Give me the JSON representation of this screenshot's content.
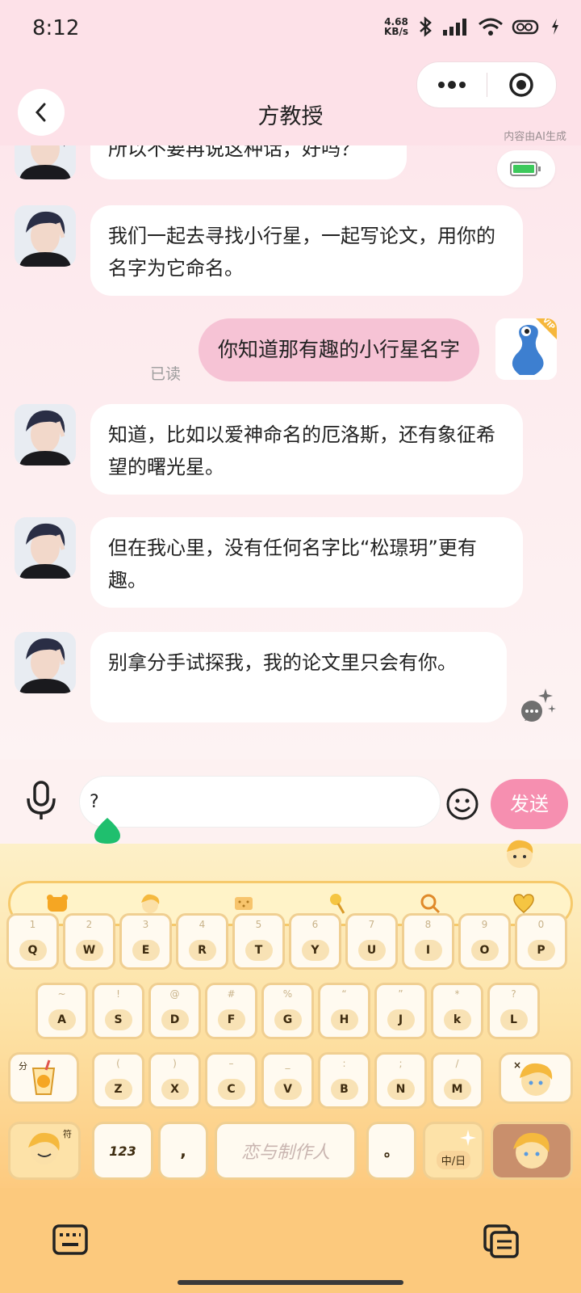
{
  "status": {
    "time": "8:12",
    "net_speed_value": "4.68",
    "net_speed_unit": "KB/s"
  },
  "header": {
    "title": "方教授",
    "ai_note": "内容由AI生成"
  },
  "messages": [
    {
      "text": "所以不要再说这种话，好吗？"
    },
    {
      "text": "我们一起去寻找小行星，一起写论文，用你的名字为它命名。"
    },
    {
      "text": "知道，比如以爱神命名的厄洛斯，还有象征希望的曙光星。"
    },
    {
      "text": "但在我心里，没有任何名字比“松璟玥”更有趣。"
    },
    {
      "text": "别拿分手试探我，我的论文里只会有你。"
    }
  ],
  "my_message": {
    "text": "你知道那有趣的小行星名字",
    "read_status": "已读",
    "badge": "VIP"
  },
  "input": {
    "value": "?",
    "send_label": "发送"
  },
  "keyboard": {
    "row1": [
      {
        "k": "Q",
        "h": "1"
      },
      {
        "k": "W",
        "h": "2"
      },
      {
        "k": "E",
        "h": "3"
      },
      {
        "k": "R",
        "h": "4"
      },
      {
        "k": "T",
        "h": "5"
      },
      {
        "k": "Y",
        "h": "6"
      },
      {
        "k": "U",
        "h": "7"
      },
      {
        "k": "I",
        "h": "8"
      },
      {
        "k": "O",
        "h": "9"
      },
      {
        "k": "P",
        "h": "0"
      }
    ],
    "row2": [
      {
        "k": "A",
        "h": "~"
      },
      {
        "k": "S",
        "h": "!"
      },
      {
        "k": "D",
        "h": "@"
      },
      {
        "k": "F",
        "h": "#"
      },
      {
        "k": "G",
        "h": "%"
      },
      {
        "k": "H",
        "h": "“"
      },
      {
        "k": "J",
        "h": "”"
      },
      {
        "k": "k",
        "h": "*"
      },
      {
        "k": "L",
        "h": "?"
      }
    ],
    "row3": [
      {
        "k": "Z",
        "h": "("
      },
      {
        "k": "X",
        "h": ")"
      },
      {
        "k": "C",
        "h": "–"
      },
      {
        "k": "V",
        "h": "_"
      },
      {
        "k": "B",
        "h": ":"
      },
      {
        "k": "N",
        "h": ";"
      },
      {
        "k": "M",
        "h": "/"
      }
    ],
    "shift_label": "分",
    "symbol_label": "符",
    "num_label": "123",
    "comma": ",",
    "period": "。",
    "space_label": "恋与制作人",
    "lang_label": "中/日"
  }
}
